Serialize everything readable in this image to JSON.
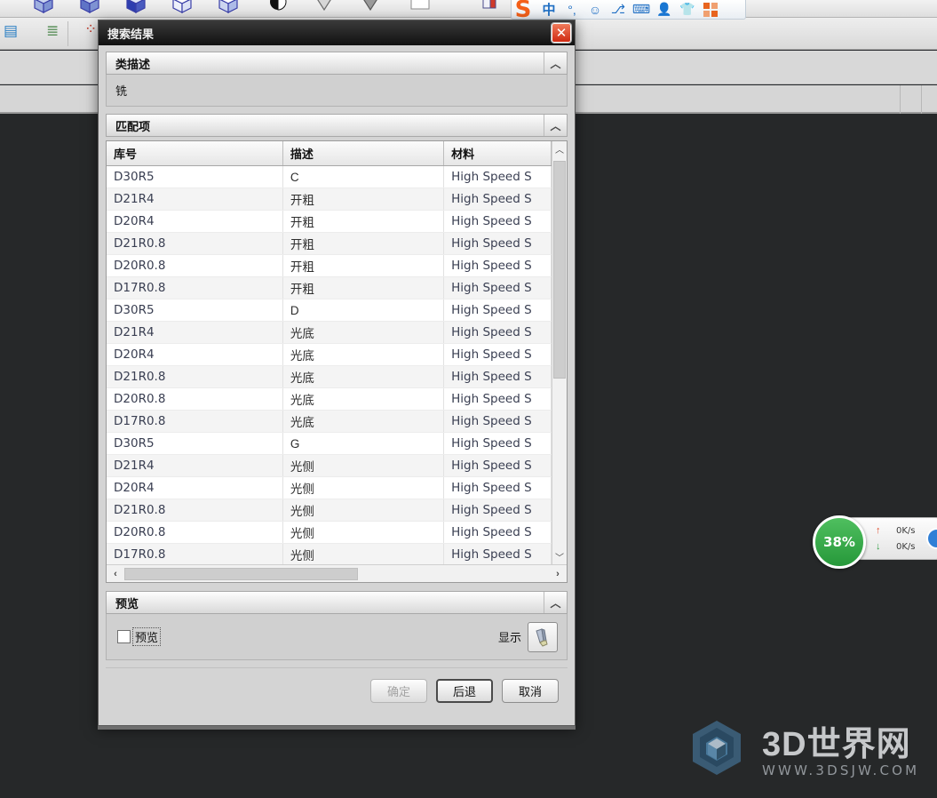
{
  "app": {
    "toolbar_icons": [
      "cube-view-icon",
      "cube-view-icon",
      "cube-view-icon",
      "cube-view-icon",
      "cube-view-icon",
      "shade-half-icon",
      "shade-down-icon",
      "shade-flat-icon",
      "blank-box-icon",
      "section-red-icon",
      "section-blue-icon",
      "dropdown-caret-icon"
    ],
    "toolbar_row2_icons": [
      "layers-icon",
      "layer-list-icon",
      "csys-axis-icon",
      "dropdown-caret-icon"
    ]
  },
  "ime": {
    "logo": "S",
    "items": [
      {
        "name": "chinese-mode-icon",
        "glyph": "中"
      },
      {
        "name": "punctuation-icon",
        "glyph": "°,"
      },
      {
        "name": "emoji-icon",
        "glyph": "☺"
      },
      {
        "name": "microphone-icon",
        "glyph": "🎤"
      },
      {
        "name": "keyboard-icon",
        "glyph": "⌨"
      },
      {
        "name": "user-icon",
        "glyph": "👤"
      },
      {
        "name": "skin-icon",
        "glyph": "👕"
      }
    ],
    "grid_icon": "app-grid-icon"
  },
  "download_widget": {
    "percent": "38%",
    "upload_speed": "0K/s",
    "download_speed": "0K/s",
    "up_arrow": "↑",
    "down_arrow": "↓"
  },
  "watermark": {
    "main": "3D世界网",
    "sub": "WWW.3DSJW.COM"
  },
  "dialog": {
    "title": "搜索结果",
    "close_label": "✕",
    "collapse_glyph": "︿",
    "class_description": {
      "header": "类描述",
      "value": "铣"
    },
    "matches": {
      "header": "匹配项",
      "columns": [
        "库号",
        "描述",
        "材料"
      ],
      "rows": [
        {
          "id": "D30R5",
          "desc": "C",
          "material": "High Speed S"
        },
        {
          "id": "D21R4",
          "desc": "开粗",
          "material": "High Speed S"
        },
        {
          "id": "D20R4",
          "desc": "开粗",
          "material": "High Speed S"
        },
        {
          "id": "D21R0.8",
          "desc": "开粗",
          "material": "High Speed S"
        },
        {
          "id": "D20R0.8",
          "desc": "开粗",
          "material": "High Speed S"
        },
        {
          "id": "D17R0.8",
          "desc": "开粗",
          "material": "High Speed S"
        },
        {
          "id": "D30R5",
          "desc": "D",
          "material": "High Speed S"
        },
        {
          "id": "D21R4",
          "desc": "光底",
          "material": "High Speed S"
        },
        {
          "id": "D20R4",
          "desc": "光底",
          "material": "High Speed S"
        },
        {
          "id": "D21R0.8",
          "desc": "光底",
          "material": "High Speed S"
        },
        {
          "id": "D20R0.8",
          "desc": "光底",
          "material": "High Speed S"
        },
        {
          "id": "D17R0.8",
          "desc": "光底",
          "material": "High Speed S"
        },
        {
          "id": "D30R5",
          "desc": "G",
          "material": "High Speed S"
        },
        {
          "id": "D21R4",
          "desc": "光侧",
          "material": "High Speed S"
        },
        {
          "id": "D20R4",
          "desc": "光侧",
          "material": "High Speed S"
        },
        {
          "id": "D21R0.8",
          "desc": "光侧",
          "material": "High Speed S"
        },
        {
          "id": "D20R0.8",
          "desc": "光侧",
          "material": "High Speed S"
        },
        {
          "id": "D17R0.8",
          "desc": "光侧",
          "material": "High Speed S"
        }
      ],
      "scroll_up": "︿",
      "scroll_down": "﹀",
      "scroll_left": "‹",
      "scroll_right": "›"
    },
    "preview": {
      "header": "预览",
      "checkbox_label": "预览",
      "checked": false,
      "show_label": "显示",
      "tool_icon": "end-mill-tool-icon"
    },
    "buttons": {
      "ok": "确定",
      "ok_disabled": true,
      "back": "后退",
      "cancel": "取消"
    }
  }
}
